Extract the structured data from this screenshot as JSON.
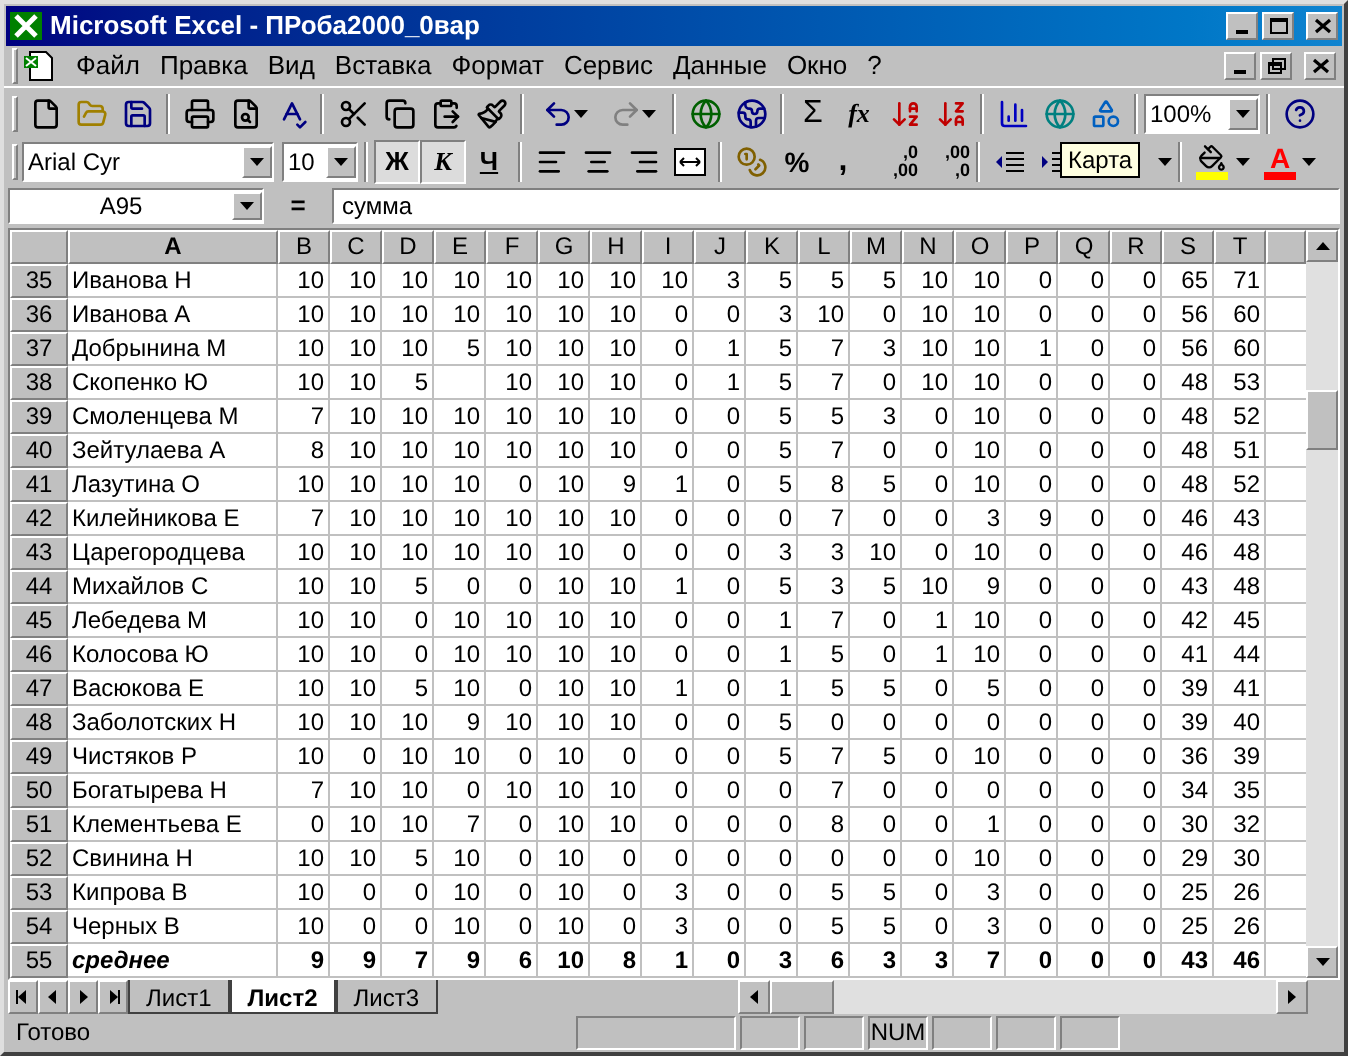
{
  "window": {
    "title": "Microsoft Excel - ПРоба2000_0вар"
  },
  "menu": [
    "Файл",
    "Правка",
    "Вид",
    "Вставка",
    "Формат",
    "Сервис",
    "Данные",
    "Окно",
    "?"
  ],
  "standard_toolbar": {
    "sum": "Σ",
    "function": "fx",
    "zoom": "100%"
  },
  "formatting_toolbar": {
    "font": "Arial Cyr",
    "size": "10",
    "styles": [
      "Ж",
      "К",
      "Ч"
    ],
    "percent": "%",
    "comma": ",",
    "decimals": [
      {
        "top": ",0",
        "bottom": ",00"
      },
      {
        "top": ",00",
        "bottom": ",0"
      }
    ],
    "fill_color_button": {
      "color": "#ffff00"
    },
    "font_color": {
      "label": "A",
      "color": "#ff0000"
    }
  },
  "tooltip": "Карта",
  "formula_bar": {
    "name_box": "A95",
    "equals": "=",
    "formula": "сумма"
  },
  "columns": [
    "A",
    "B",
    "C",
    "D",
    "E",
    "F",
    "G",
    "H",
    "I",
    "J",
    "K",
    "L",
    "M",
    "N",
    "O",
    "P",
    "Q",
    "R",
    "S",
    "T"
  ],
  "rows": [
    {
      "num": "35",
      "kind": "data",
      "name": "Иванова Н",
      "cells": [
        "10",
        "10",
        "10",
        "10",
        "10",
        "10",
        "10",
        "10",
        "3",
        "5",
        "5",
        "5",
        "10",
        "10",
        "0",
        "0",
        "0",
        "65",
        "71"
      ]
    },
    {
      "num": "36",
      "kind": "data",
      "name": "Иванова А",
      "cells": [
        "10",
        "10",
        "10",
        "10",
        "10",
        "10",
        "10",
        "0",
        "0",
        "3",
        "10",
        "0",
        "10",
        "10",
        "0",
        "0",
        "0",
        "56",
        "60"
      ]
    },
    {
      "num": "37",
      "kind": "data",
      "name": "Добрынина М",
      "cells": [
        "10",
        "10",
        "10",
        "5",
        "10",
        "10",
        "10",
        "0",
        "1",
        "5",
        "7",
        "3",
        "10",
        "10",
        "1",
        "0",
        "0",
        "56",
        "60"
      ]
    },
    {
      "num": "38",
      "kind": "data",
      "name": "Скопенко Ю",
      "cells": [
        "10",
        "10",
        "5",
        "",
        "10",
        "10",
        "10",
        "0",
        "1",
        "5",
        "7",
        "0",
        "10",
        "10",
        "0",
        "0",
        "0",
        "48",
        "53"
      ]
    },
    {
      "num": "39",
      "kind": "data",
      "name": "Смоленцева М",
      "cells": [
        "7",
        "10",
        "10",
        "10",
        "10",
        "10",
        "10",
        "0",
        "0",
        "5",
        "5",
        "3",
        "0",
        "10",
        "0",
        "0",
        "0",
        "48",
        "52"
      ]
    },
    {
      "num": "40",
      "kind": "data",
      "name": "Зейтулаева А",
      "cells": [
        "8",
        "10",
        "10",
        "10",
        "10",
        "10",
        "10",
        "0",
        "0",
        "5",
        "7",
        "0",
        "0",
        "10",
        "0",
        "0",
        "0",
        "48",
        "51"
      ]
    },
    {
      "num": "41",
      "kind": "data",
      "name": "Лазутина О",
      "cells": [
        "10",
        "10",
        "10",
        "10",
        "0",
        "10",
        "9",
        "1",
        "0",
        "5",
        "8",
        "5",
        "0",
        "10",
        "0",
        "0",
        "0",
        "48",
        "52"
      ]
    },
    {
      "num": "42",
      "kind": "data",
      "name": "Килейникова Е",
      "cells": [
        "7",
        "10",
        "10",
        "10",
        "10",
        "10",
        "10",
        "0",
        "0",
        "0",
        "7",
        "0",
        "0",
        "3",
        "9",
        "0",
        "0",
        "46",
        "43"
      ]
    },
    {
      "num": "43",
      "kind": "data",
      "name": "Царегородцева",
      "cells": [
        "10",
        "10",
        "10",
        "10",
        "10",
        "10",
        "0",
        "0",
        "0",
        "3",
        "3",
        "10",
        "0",
        "10",
        "0",
        "0",
        "0",
        "46",
        "48"
      ]
    },
    {
      "num": "44",
      "kind": "data",
      "name": "Михайлов С",
      "cells": [
        "10",
        "10",
        "5",
        "0",
        "0",
        "10",
        "10",
        "1",
        "0",
        "5",
        "3",
        "5",
        "10",
        "9",
        "0",
        "0",
        "0",
        "43",
        "48"
      ]
    },
    {
      "num": "45",
      "kind": "data",
      "name": "Лебедева М",
      "cells": [
        "10",
        "10",
        "0",
        "10",
        "10",
        "10",
        "10",
        "0",
        "0",
        "1",
        "7",
        "0",
        "1",
        "10",
        "0",
        "0",
        "0",
        "42",
        "45"
      ]
    },
    {
      "num": "46",
      "kind": "data",
      "name": "Колосова Ю",
      "cells": [
        "10",
        "10",
        "0",
        "10",
        "10",
        "10",
        "10",
        "0",
        "0",
        "1",
        "5",
        "0",
        "1",
        "10",
        "0",
        "0",
        "0",
        "41",
        "44"
      ]
    },
    {
      "num": "47",
      "kind": "data",
      "name": "Васюкова Е",
      "cells": [
        "10",
        "10",
        "5",
        "10",
        "0",
        "10",
        "10",
        "1",
        "0",
        "1",
        "5",
        "5",
        "0",
        "5",
        "0",
        "0",
        "0",
        "39",
        "41"
      ]
    },
    {
      "num": "48",
      "kind": "data",
      "name": "Заболотских Н",
      "cells": [
        "10",
        "10",
        "10",
        "9",
        "10",
        "10",
        "10",
        "0",
        "0",
        "5",
        "0",
        "0",
        "0",
        "0",
        "0",
        "0",
        "0",
        "39",
        "40"
      ]
    },
    {
      "num": "49",
      "kind": "data",
      "name": "Чистяков Р",
      "cells": [
        "10",
        "0",
        "10",
        "10",
        "0",
        "10",
        "0",
        "0",
        "0",
        "5",
        "7",
        "5",
        "0",
        "10",
        "0",
        "0",
        "0",
        "36",
        "39"
      ]
    },
    {
      "num": "50",
      "kind": "data",
      "name": "Богатырева Н",
      "cells": [
        "7",
        "10",
        "10",
        "0",
        "10",
        "10",
        "10",
        "0",
        "0",
        "0",
        "7",
        "0",
        "0",
        "0",
        "0",
        "0",
        "0",
        "34",
        "35"
      ]
    },
    {
      "num": "51",
      "kind": "data",
      "name": "Клементьева Е",
      "cells": [
        "0",
        "10",
        "10",
        "7",
        "0",
        "10",
        "10",
        "0",
        "0",
        "0",
        "8",
        "0",
        "0",
        "1",
        "0",
        "0",
        "0",
        "30",
        "32"
      ]
    },
    {
      "num": "52",
      "kind": "data",
      "name": "Свинина Н",
      "cells": [
        "10",
        "10",
        "5",
        "10",
        "0",
        "10",
        "0",
        "0",
        "0",
        "0",
        "0",
        "0",
        "0",
        "10",
        "0",
        "0",
        "0",
        "29",
        "30"
      ]
    },
    {
      "num": "53",
      "kind": "data",
      "name": "Кипрова В",
      "cells": [
        "10",
        "0",
        "0",
        "10",
        "0",
        "10",
        "0",
        "3",
        "0",
        "0",
        "5",
        "5",
        "0",
        "3",
        "0",
        "0",
        "0",
        "25",
        "26"
      ]
    },
    {
      "num": "54",
      "kind": "data",
      "name": "Черных В",
      "cells": [
        "10",
        "0",
        "0",
        "10",
        "0",
        "10",
        "0",
        "3",
        "0",
        "0",
        "5",
        "5",
        "0",
        "3",
        "0",
        "0",
        "0",
        "25",
        "26"
      ]
    },
    {
      "num": "55",
      "kind": "summary",
      "name": "среднее",
      "cells": [
        "9",
        "9",
        "7",
        "9",
        "6",
        "10",
        "8",
        "1",
        "0",
        "3",
        "6",
        "3",
        "3",
        "7",
        "0",
        "0",
        "0",
        "43",
        "46"
      ]
    }
  ],
  "sheet_tabs": [
    {
      "label": "Лист1",
      "selected": false
    },
    {
      "label": "Лист2",
      "selected": true
    },
    {
      "label": "Лист3",
      "selected": false
    }
  ],
  "status_bar": {
    "text": "Готово",
    "num_lock": "NUM"
  }
}
